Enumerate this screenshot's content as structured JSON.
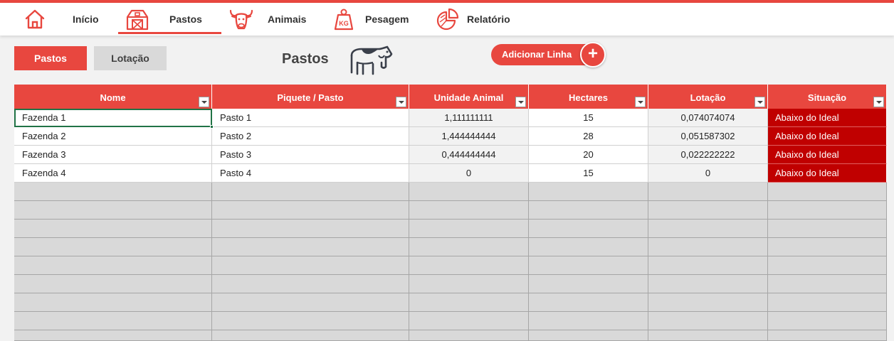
{
  "nav": {
    "items": [
      {
        "label": "Início",
        "icon": "home-icon"
      },
      {
        "label": "Pastos",
        "icon": "barn-icon"
      },
      {
        "label": "Animais",
        "icon": "bull-icon"
      },
      {
        "label": "Pesagem",
        "icon": "weight-icon"
      },
      {
        "label": "Relatório",
        "icon": "pie-chart-icon"
      }
    ],
    "active": "Pastos"
  },
  "toolbar": {
    "pastos_label": "Pastos",
    "lotacao_label": "Lotação",
    "add_row_label": "Adicionar Linha",
    "add_icon": "plus-icon"
  },
  "page": {
    "title": "Pastos",
    "icon": "cow-icon"
  },
  "colors": {
    "accent": "#e8473f",
    "status_bad": "#c00000",
    "empty_row": "#d9d9d9",
    "selection": "#217346"
  },
  "table": {
    "columns": [
      "Nome",
      "Piquete / Pasto",
      "Unidade Animal",
      "Hectares",
      "Lotação",
      "Situação"
    ],
    "rows": [
      {
        "nome": "Fazenda 1",
        "piquete": "Pasto 1",
        "ua": "1,111111111",
        "hectares": "15",
        "lotacao": "0,074074074",
        "situacao": "Abaixo do Ideal"
      },
      {
        "nome": "Fazenda 2",
        "piquete": "Pasto 2",
        "ua": "1,444444444",
        "hectares": "28",
        "lotacao": "0,051587302",
        "situacao": "Abaixo do Ideal"
      },
      {
        "nome": "Fazenda 3",
        "piquete": "Pasto 3",
        "ua": "0,444444444",
        "hectares": "20",
        "lotacao": "0,022222222",
        "situacao": "Abaixo do Ideal"
      },
      {
        "nome": "Fazenda 4",
        "piquete": "Pasto 4",
        "ua": "0",
        "hectares": "15",
        "lotacao": "0",
        "situacao": "Abaixo do Ideal"
      }
    ],
    "selected_cell": "Fazenda 1"
  }
}
